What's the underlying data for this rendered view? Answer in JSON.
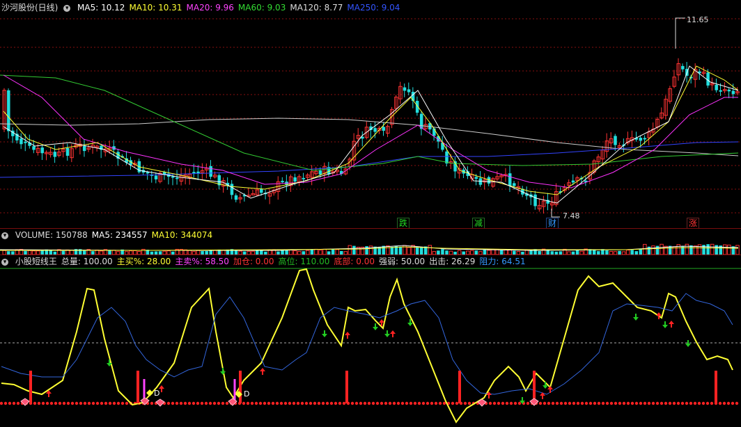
{
  "price_panel": {
    "stock_title": "沙河股份(日线)",
    "ma": [
      {
        "label": "MA5: 10.12",
        "color": "#ffffff"
      },
      {
        "label": "MA10: 10.31",
        "color": "#ffff33"
      },
      {
        "label": "MA20: 9.96",
        "color": "#ff44ff"
      },
      {
        "label": "MA60: 9.03",
        "color": "#33dd33"
      },
      {
        "label": "MA120: 8.77",
        "color": "#dddddd"
      },
      {
        "label": "MA250: 9.04",
        "color": "#3355ff"
      }
    ],
    "high_label": "11.65",
    "low_label": "7.48",
    "marks": [
      {
        "text": "跌",
        "color": "#22dd22"
      },
      {
        "text": "减",
        "color": "#22dd22"
      },
      {
        "text": "财",
        "color": "#3399ff"
      },
      {
        "text": "涨",
        "color": "#ff3333"
      }
    ]
  },
  "volume_panel": {
    "labels": [
      {
        "text": "VOLUME: 150788",
        "color": "#dddddd"
      },
      {
        "text": "MA5: 234557",
        "color": "#ffffff"
      },
      {
        "text": "MA10: 344074",
        "color": "#ffff33"
      }
    ]
  },
  "indicator_panel": {
    "labels": [
      {
        "text": "小股短线王",
        "color": "#dddddd"
      },
      {
        "text": "总量: 100.00",
        "color": "#dddddd"
      },
      {
        "text": "主买%: 28.00",
        "color": "#ffff33"
      },
      {
        "text": "主卖%: 58.50",
        "color": "#ff44ff"
      },
      {
        "text": "加仓: 0.00",
        "color": "#ff3333"
      },
      {
        "text": "高位: 110.00",
        "color": "#22bb22"
      },
      {
        "text": "底部: 0.00",
        "color": "#ff3333"
      },
      {
        "text": "强弱: 50.00",
        "color": "#dddddd"
      },
      {
        "text": "出击: 26.29",
        "color": "#dddddd"
      },
      {
        "text": "阻力: 64.51",
        "color": "#3399ff"
      }
    ],
    "d_label": "D"
  },
  "colors": {
    "up": "#ff3333",
    "down": "#22dddd",
    "grid": "#8a1010"
  }
}
